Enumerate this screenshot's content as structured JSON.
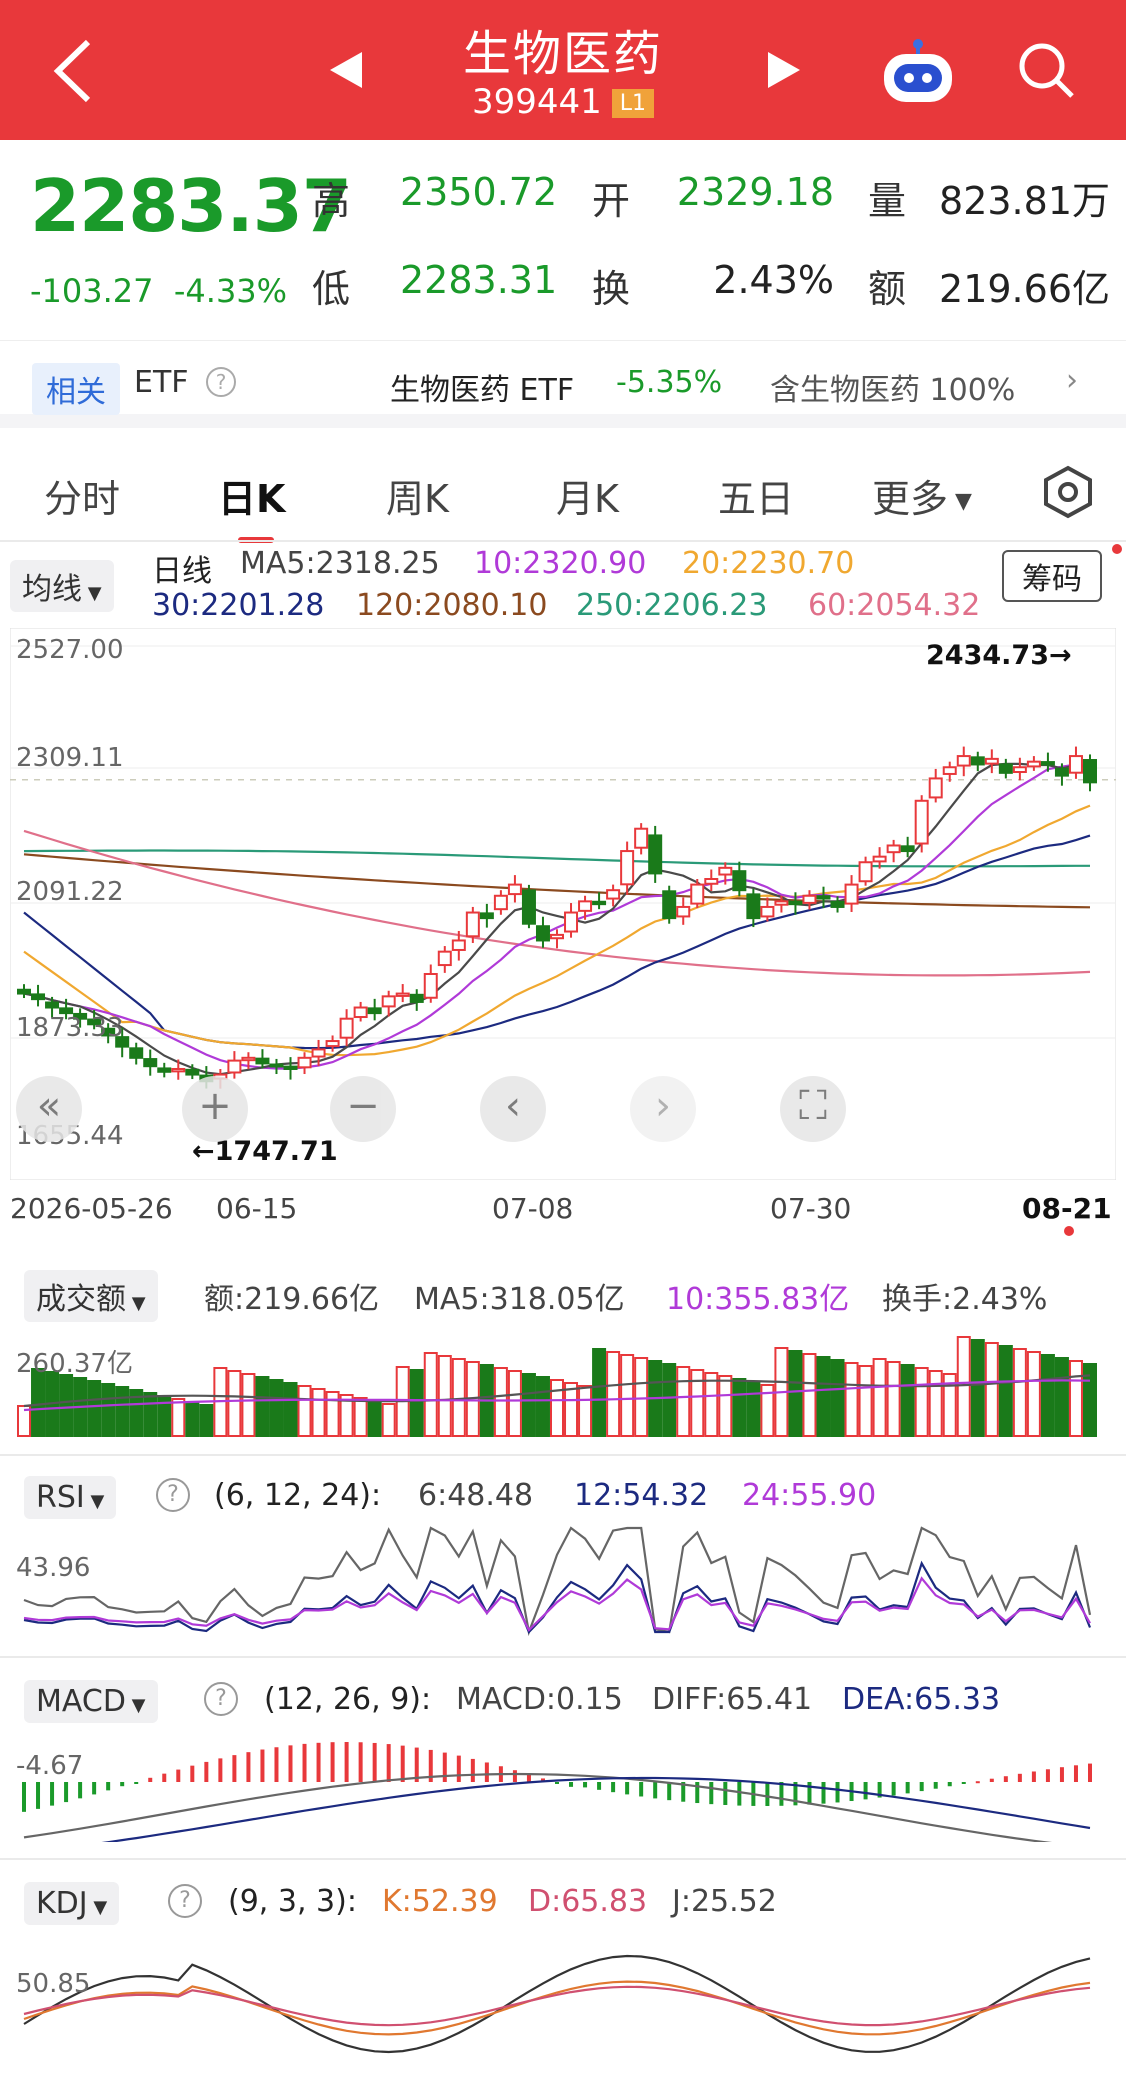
{
  "header": {
    "title": "生物医药",
    "code": "399441",
    "level": "L1"
  },
  "quote": {
    "price": "2283.37",
    "change": "-103.27",
    "change_pct": "-4.33%",
    "high_label": "高",
    "high": "2350.72",
    "open_label": "开",
    "open": "2329.18",
    "vol_label": "量",
    "vol": "823.81万",
    "low_label": "低",
    "low": "2283.31",
    "turn_label": "换",
    "turn": "2.43%",
    "amt_label": "额",
    "amt": "219.66亿"
  },
  "etf": {
    "related": "相关",
    "label": "ETF",
    "name": "生物医药 ETF",
    "pct": "-5.35%",
    "include": "含生物医药 100%"
  },
  "tabs": [
    "分时",
    "日K",
    "周K",
    "月K",
    "五日",
    "更多"
  ],
  "ma": {
    "selector": "均线",
    "period": "日线",
    "ma5": "MA5:2318.25",
    "ma10": "10:2320.90",
    "ma20": "20:2230.70",
    "ma30": "30:2201.28",
    "ma120": "120:2080.10",
    "ma250": "250:2206.23",
    "ma60": "60:2054.32",
    "chips": "筹码"
  },
  "kchart": {
    "y_labels": [
      "2527.00",
      "2309.11",
      "2091.22",
      "1873.33",
      "1655.44"
    ],
    "max_label": "2434.73→",
    "min_label": "←1747.71",
    "dates": [
      "2026-05-26",
      "06-15",
      "07-08",
      "07-30",
      "08-21"
    ]
  },
  "volume": {
    "selector": "成交额",
    "amt": "额:219.66亿",
    "ma5": "MA5:318.05亿",
    "ma10": "10:355.83亿",
    "turn": "换手:2.43%",
    "y_label": "260.37亿"
  },
  "rsi": {
    "selector": "RSI",
    "params": "(6, 12, 24):",
    "v6": "6:48.48",
    "v12": "12:54.32",
    "v24": "24:55.90",
    "y_label": "43.96"
  },
  "macd": {
    "selector": "MACD",
    "params": "(12, 26, 9):",
    "macd": "MACD:0.15",
    "diff": "DIFF:65.41",
    "dea": "DEA:65.33",
    "y_label": "-4.67"
  },
  "kdj": {
    "selector": "KDJ",
    "params": "(9, 3, 3):",
    "k": "K:52.39",
    "d": "D:65.83",
    "j": "J:25.52",
    "y_label": "50.85"
  },
  "colors": {
    "header": "#e8383b",
    "up": "#e8383b",
    "down": "#1a7a1a",
    "ma5": "#4a4a4a",
    "ma10": "#b03ad8",
    "ma20": "#f0a830",
    "ma30": "#1c2a80",
    "ma120": "#8b4a1f",
    "ma250": "#2a9a78",
    "ma60": "#e0708a"
  },
  "chart_data": {
    "type": "candlestick",
    "closes": [
      1905,
      1895,
      1880,
      1870,
      1860,
      1850,
      1830,
      1810,
      1790,
      1775,
      1765,
      1770,
      1760,
      1748,
      1760,
      1785,
      1790,
      1780,
      1775,
      1770,
      1790,
      1805,
      1820,
      1860,
      1880,
      1870,
      1900,
      1905,
      1890,
      1940,
      1980,
      2000,
      2050,
      2040,
      2080,
      2100,
      2030,
      2000,
      2010,
      2050,
      2070,
      2065,
      2090,
      2160,
      2200,
      2120,
      2040,
      2060,
      2100,
      2110,
      2130,
      2090,
      2040,
      2060,
      2070,
      2065,
      2080,
      2075,
      2060,
      2100,
      2140,
      2150,
      2170,
      2160,
      2250,
      2290,
      2310,
      2330,
      2315,
      2325,
      2300,
      2310,
      2320,
      2315,
      2295,
      2330,
      2283
    ]
  }
}
